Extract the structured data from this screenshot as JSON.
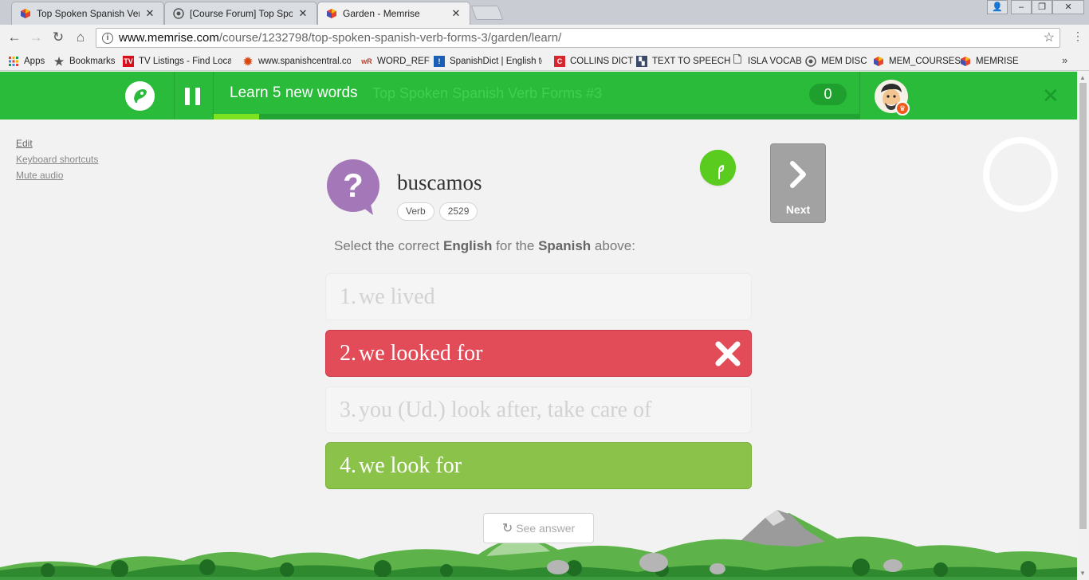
{
  "browser": {
    "tabs": [
      {
        "title": "Top Spoken Spanish Verb F",
        "active": false
      },
      {
        "title": "[Course Forum] Top Spoke",
        "active": false
      },
      {
        "title": "Garden - Memrise",
        "active": true
      }
    ],
    "url_host": "www.memrise.com",
    "url_path": "/course/1232798/top-spoken-spanish-verb-forms-3/garden/learn/",
    "bookmarks": [
      "Apps",
      "Bookmarks",
      "TV Listings - Find Local",
      "www.spanishcentral.cor",
      "WORD_REF",
      "SpanishDict | English to",
      "COLLINS DICT",
      "TEXT TO SPEECH",
      "ISLA VOCAB",
      "MEM DISC",
      "MEM_COURSES",
      "MEMRISE"
    ],
    "more": "»"
  },
  "topbar": {
    "title": "Learn 5 new words",
    "course": "Top Spoken Spanish Verb Forms #3",
    "score": "0",
    "progress": 0.07,
    "close": "✕"
  },
  "sidebar": {
    "edit": "Edit",
    "shortcuts": "Keyboard shortcuts",
    "mute": "Mute audio"
  },
  "card": {
    "word": "buscamos",
    "tags": [
      "Verb",
      "2529"
    ],
    "next_label": "Next"
  },
  "prompt": {
    "pre": "Select the correct ",
    "lang1": "English",
    "mid": " for the ",
    "lang2": "Spanish",
    "post": " above:"
  },
  "choices": [
    {
      "num": "1.",
      "text": "we lived",
      "state": "faded"
    },
    {
      "num": "2.",
      "text": "we looked for",
      "state": "wrong"
    },
    {
      "num": "3.",
      "text": "you (Ud.) look after, take care of",
      "state": "faded"
    },
    {
      "num": "4.",
      "text": "we look for",
      "state": "right"
    }
  ],
  "see_answer": "See answer",
  "colors": {
    "brand_green": "#2abb3b",
    "wrong_red": "#e24b58",
    "right_green": "#8bc34a"
  }
}
